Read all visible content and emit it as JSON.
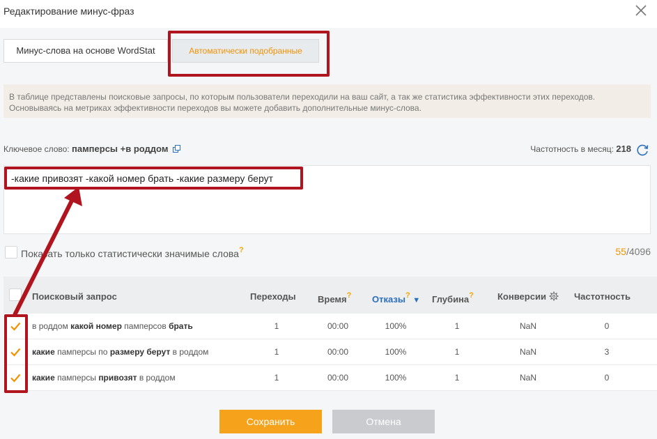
{
  "dialog": {
    "title": "Редактирование минус-фраз",
    "close_icon": "close-icon"
  },
  "tabs": [
    {
      "label": "Минус-слова на основе WordStat",
      "active": false
    },
    {
      "label": "Автоматически подобранные",
      "active": true
    }
  ],
  "info_text": "В таблице представлены поисковые запросы, по которым пользователи переходили на ваш сайт, а так же статистика эффективности этих переходов. Основываясь на метриках эффективности переходов вы можете добавить дополнительные минус-слова.",
  "keyword": {
    "label": "Ключевое слово:",
    "value": "памперсы +в роддом"
  },
  "frequency": {
    "label": "Частотность в месяц:",
    "value": "218"
  },
  "minus_phrases": "-какие привозят -какой номер брать -какие размеру берут",
  "only_significant": {
    "label": "Показать только статистически значимые слова",
    "help": "?",
    "checked": false
  },
  "counter": {
    "used": "55",
    "limit": "/4096"
  },
  "table": {
    "headers": {
      "query": "Поисковый запрос",
      "clicks": "Переходы",
      "time": "Время",
      "bounces": "Отказы",
      "depth": "Глубина",
      "conversions": "Конверсии",
      "frequency": "Частотность"
    },
    "help": "?",
    "sort_indicator": "▼",
    "rows": [
      {
        "checked": true,
        "parts": [
          {
            "t": "в роддом ",
            "b": false
          },
          {
            "t": "какой номер",
            "b": true
          },
          {
            "t": " памперсов ",
            "b": false
          },
          {
            "t": "брать",
            "b": true
          }
        ],
        "clicks": "1",
        "time": "00:00",
        "bounces": "100%",
        "depth": "1",
        "conversions": "NaN",
        "frequency": "0"
      },
      {
        "checked": true,
        "parts": [
          {
            "t": "какие",
            "b": true
          },
          {
            "t": " памперсы по ",
            "b": false
          },
          {
            "t": "размеру берут",
            "b": true
          },
          {
            "t": " в роддом",
            "b": false
          }
        ],
        "clicks": "1",
        "time": "00:00",
        "bounces": "100%",
        "depth": "1",
        "conversions": "NaN",
        "frequency": "3"
      },
      {
        "checked": true,
        "parts": [
          {
            "t": "какие",
            "b": true
          },
          {
            "t": " памперсы ",
            "b": false
          },
          {
            "t": "привозят",
            "b": true
          },
          {
            "t": " в роддом",
            "b": false
          }
        ],
        "clicks": "1",
        "time": "00:00",
        "bounces": "100%",
        "depth": "1",
        "conversions": "NaN",
        "frequency": "0"
      }
    ]
  },
  "buttons": {
    "save": "Сохранить",
    "cancel": "Отмена"
  },
  "colors": {
    "accent": "#f7a21b",
    "highlight": "#b0141e",
    "link": "#2a6ebd",
    "cancel": "#c9cbce"
  }
}
